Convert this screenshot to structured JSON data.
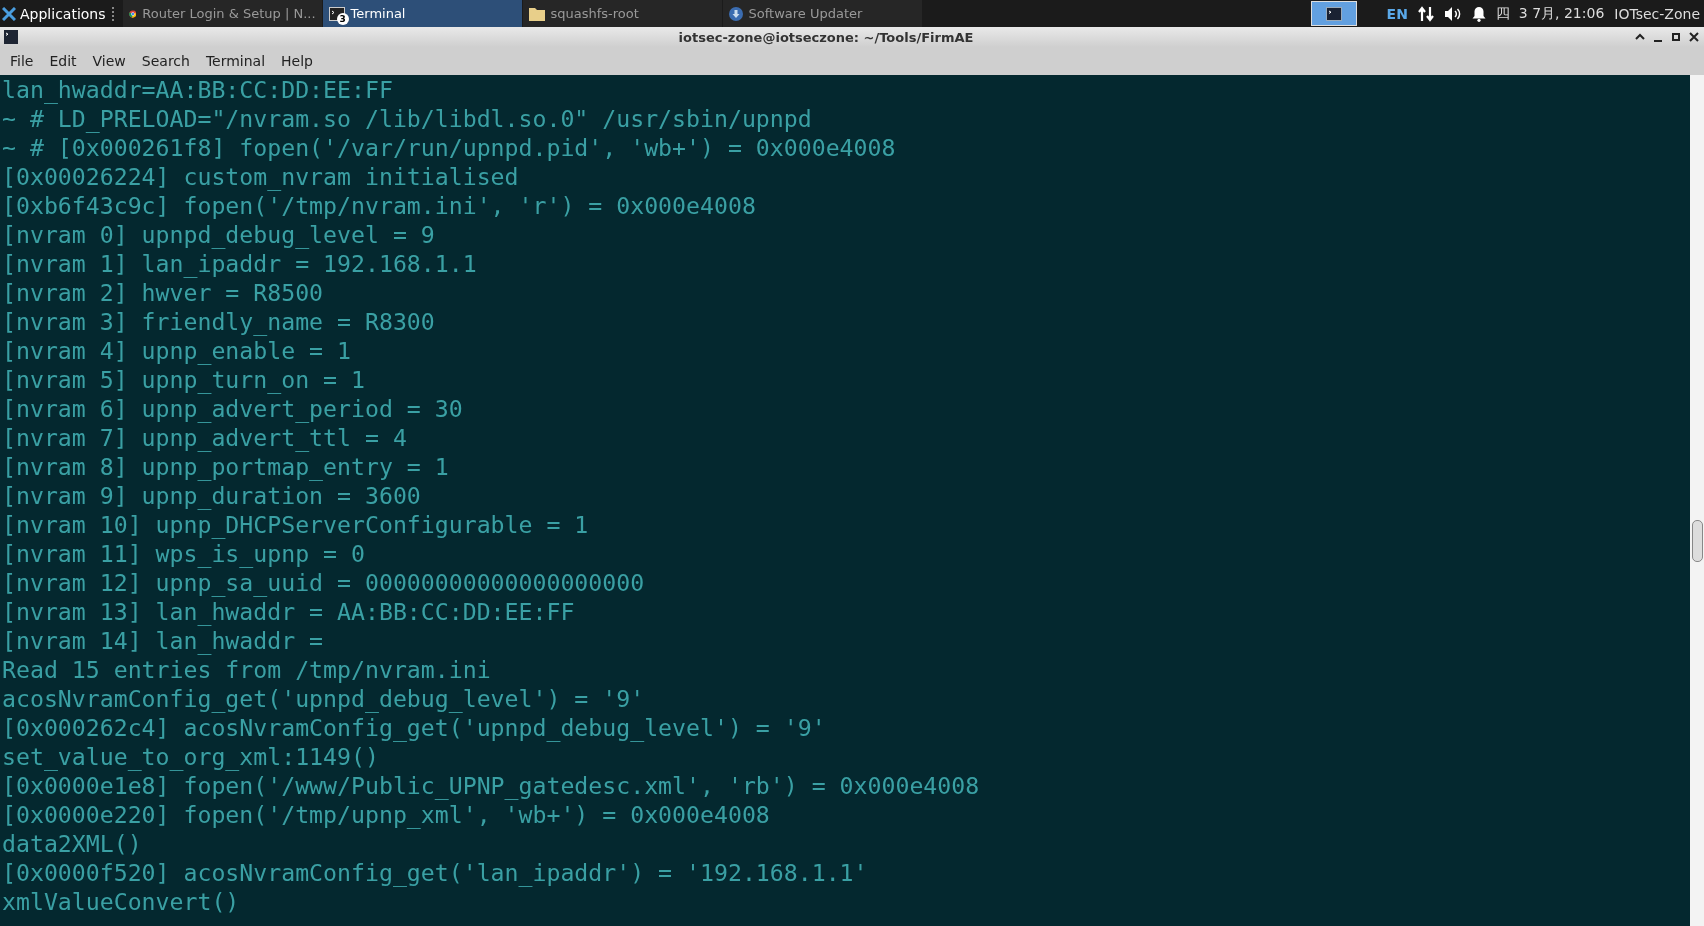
{
  "taskbar": {
    "menu_label": "Applications",
    "tasks": [
      {
        "kind": "browser",
        "label": "Router Login & Setup | N...",
        "selected": false
      },
      {
        "kind": "terminal",
        "label": "Terminal",
        "selected": true,
        "badge": "3"
      },
      {
        "kind": "folder",
        "label": "squashfs-root",
        "selected": false
      },
      {
        "kind": "updater",
        "label": "Software Updater",
        "selected": false
      }
    ],
    "workspaces": [
      {
        "selected": true
      }
    ],
    "keyboard": "EN",
    "clock": "四  3 7月, 21:06",
    "user": "IOTsec-Zone"
  },
  "window": {
    "title": "iotsec-zone@iotseczone: ~/Tools/FirmAE"
  },
  "menu": [
    "File",
    "Edit",
    "View",
    "Search",
    "Terminal",
    "Help"
  ],
  "terminal": {
    "lines": [
      "lan_hwaddr=AA:BB:CC:DD:EE:FF",
      "~ # LD_PRELOAD=\"/nvram.so /lib/libdl.so.0\" /usr/sbin/upnpd",
      "~ # [0x000261f8] fopen('/var/run/upnpd.pid', 'wb+') = 0x000e4008",
      "[0x00026224] custom_nvram initialised",
      "[0xb6f43c9c] fopen('/tmp/nvram.ini', 'r') = 0x000e4008",
      "[nvram 0] upnpd_debug_level = 9",
      "[nvram 1] lan_ipaddr = 192.168.1.1",
      "[nvram 2] hwver = R8500",
      "[nvram 3] friendly_name = R8300",
      "[nvram 4] upnp_enable = 1",
      "[nvram 5] upnp_turn_on = 1",
      "[nvram 6] upnp_advert_period = 30",
      "[nvram 7] upnp_advert_ttl = 4",
      "[nvram 8] upnp_portmap_entry = 1",
      "[nvram 9] upnp_duration = 3600",
      "[nvram 10] upnp_DHCPServerConfigurable = 1",
      "[nvram 11] wps_is_upnp = 0",
      "[nvram 12] upnp_sa_uuid = 00000000000000000000",
      "[nvram 13] lan_hwaddr = AA:BB:CC:DD:EE:FF",
      "[nvram 14] lan_hwaddr =",
      "Read 15 entries from /tmp/nvram.ini",
      "acosNvramConfig_get('upnpd_debug_level') = '9'",
      "[0x000262c4] acosNvramConfig_get('upnpd_debug_level') = '9'",
      "set_value_to_org_xml:1149()",
      "[0x0000e1e8] fopen('/www/Public_UPNP_gatedesc.xml', 'rb') = 0x000e4008",
      "[0x0000e220] fopen('/tmp/upnp_xml', 'wb+') = 0x000e4008",
      "data2XML()",
      "[0x0000f520] acosNvramConfig_get('lan_ipaddr') = '192.168.1.1'",
      "xmlValueConvert()"
    ]
  }
}
